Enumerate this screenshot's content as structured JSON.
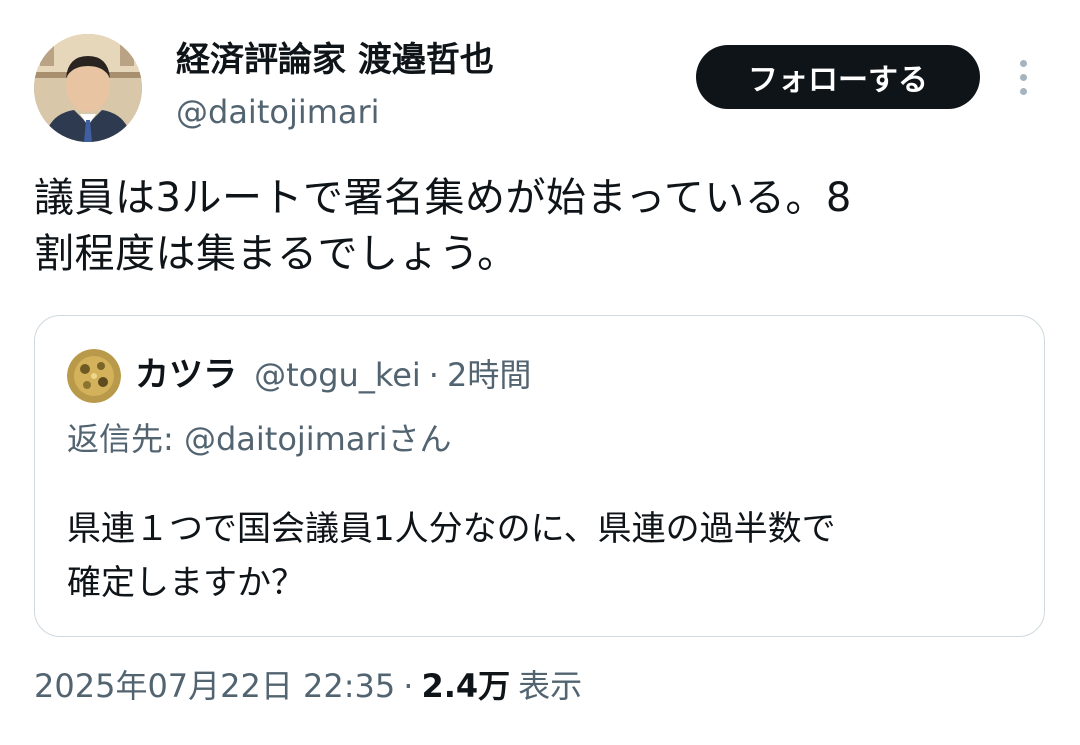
{
  "author": {
    "display_name": "経済評論家 渡邉哲也",
    "handle": "@daitojimari"
  },
  "follow_label": "フォローする",
  "tweet": {
    "text_line1": "議員は3ルートで署名集めが始まっている。8",
    "text_line2": "割程度は集まるでしょう。"
  },
  "quote": {
    "name": "カツラ",
    "handle": "@togu_kei",
    "separator": "·",
    "time": "2時間",
    "reply_to": "返信先: @daitojimariさん",
    "text_line1": "県連１つで国会議員1人分なのに、県連の過半数で",
    "text_line2": "確定しますか？"
  },
  "footer": {
    "timestamp": "2025年07月22日 22:35",
    "separator": "·",
    "views_count": "2.4万",
    "views_label": "表示"
  },
  "colors": {
    "text_primary": "#0f1419",
    "text_secondary": "#536471",
    "follow_bg": "#0f1419",
    "border": "#cfd9de"
  },
  "icons": {
    "more": "more-vertical-icon"
  }
}
